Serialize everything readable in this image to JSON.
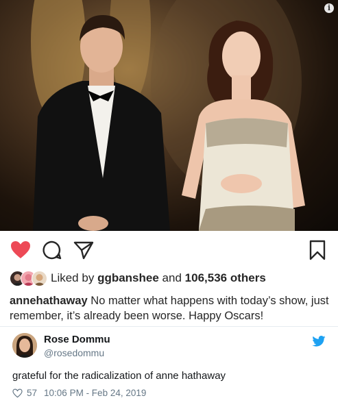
{
  "post": {
    "photo_alt": "",
    "liked_by_prefix": "Liked by",
    "liked_by_user": "ggbanshee",
    "liked_by_joiner": "and",
    "liked_by_count": "106,536 others",
    "caption_user": "annehathaway",
    "caption_text": " No matter what happens with today’s show, just remember, it’s already been worse. Happy Oscars!",
    "heart_color": "#ed4956",
    "icons": [
      "heart-icon",
      "comment-icon",
      "share-icon",
      "bookmark-icon",
      "info-icon"
    ]
  },
  "tweet": {
    "name": "Rose Dommu",
    "handle": "@rosedommu",
    "text": "grateful for the radicalization of anne hathaway",
    "likes": "57",
    "timestamp": "10:06 PM - Feb 24, 2019",
    "brand_color": "#1da1f2"
  }
}
